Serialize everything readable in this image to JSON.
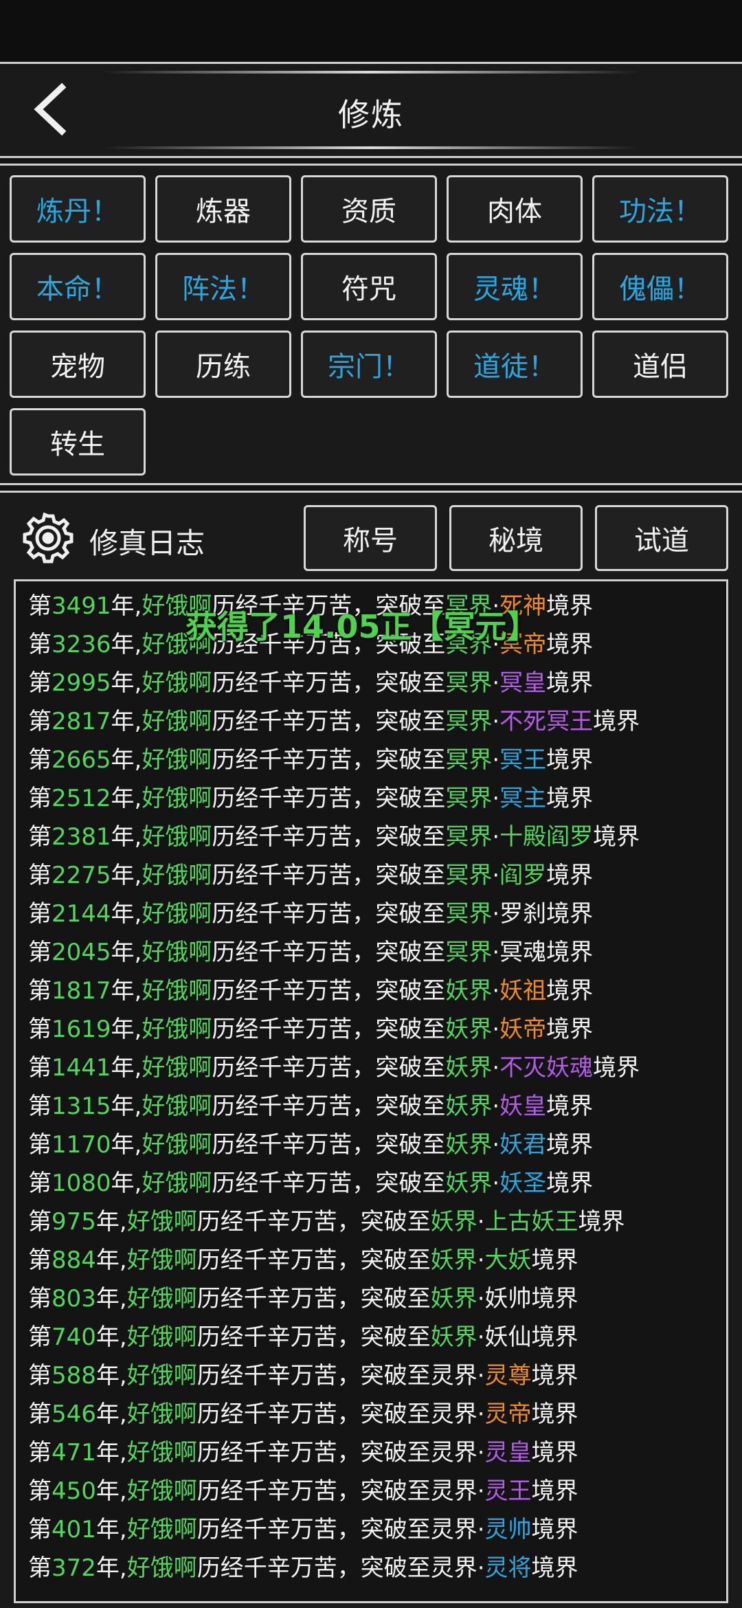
{
  "header": {
    "title": "修炼"
  },
  "feature_buttons": [
    {
      "label": "炼丹！",
      "alert": true
    },
    {
      "label": "炼器",
      "alert": false
    },
    {
      "label": "资质",
      "alert": false
    },
    {
      "label": "肉体",
      "alert": false
    },
    {
      "label": "功法！",
      "alert": true
    },
    {
      "label": "本命！",
      "alert": true
    },
    {
      "label": "阵法！",
      "alert": true
    },
    {
      "label": "符咒",
      "alert": false
    },
    {
      "label": "灵魂！",
      "alert": true
    },
    {
      "label": "傀儡！",
      "alert": true
    },
    {
      "label": "宠物",
      "alert": false
    },
    {
      "label": "历练",
      "alert": false
    },
    {
      "label": "宗门！",
      "alert": true
    },
    {
      "label": "道徒！",
      "alert": true
    },
    {
      "label": "道侣",
      "alert": false
    },
    {
      "label": "转生",
      "alert": false
    }
  ],
  "log_panel": {
    "title": "修真日志",
    "tabs": [
      "称号",
      "秘境",
      "试道"
    ]
  },
  "toast": "获得了14.05正【冥元】",
  "colors": {
    "green": "#54d65e",
    "orange": "#f08a24",
    "purple": "#b35ce8",
    "blue": "#2aa7e0",
    "white": "#f2f2f2",
    "alert": "#2aa7e0"
  },
  "log_entries": [
    {
      "prefix": "第",
      "year": "3491",
      "mid": "年,",
      "name": "好饿啊",
      "text": "历经千辛万苦，突破至",
      "realm": "冥界",
      "realm_color": "green",
      "dot": "·",
      "rank": "死神",
      "rank_color": "orange",
      "suffix": "境界"
    },
    {
      "prefix": "第",
      "year": "3236",
      "mid": "年,",
      "name": "好饿啊",
      "text": "历经千辛万苦，突破至",
      "realm": "冥界",
      "realm_color": "green",
      "dot": "·",
      "rank": "冥帝",
      "rank_color": "orange",
      "suffix": "境界"
    },
    {
      "prefix": "第",
      "year": "2995",
      "mid": "年,",
      "name": "好饿啊",
      "text": "历经千辛万苦，突破至",
      "realm": "冥界",
      "realm_color": "green",
      "dot": "·",
      "rank": "冥皇",
      "rank_color": "purple",
      "suffix": "境界"
    },
    {
      "prefix": "第",
      "year": "2817",
      "mid": "年,",
      "name": "好饿啊",
      "text": "历经千辛万苦，突破至",
      "realm": "冥界",
      "realm_color": "green",
      "dot": "·",
      "rank": "不死冥王",
      "rank_color": "purple",
      "suffix": "境界"
    },
    {
      "prefix": "第",
      "year": "2665",
      "mid": "年,",
      "name": "好饿啊",
      "text": "历经千辛万苦，突破至",
      "realm": "冥界",
      "realm_color": "green",
      "dot": "·",
      "rank": "冥王",
      "rank_color": "blue",
      "suffix": "境界"
    },
    {
      "prefix": "第",
      "year": "2512",
      "mid": "年,",
      "name": "好饿啊",
      "text": "历经千辛万苦，突破至",
      "realm": "冥界",
      "realm_color": "green",
      "dot": "·",
      "rank": "冥主",
      "rank_color": "blue",
      "suffix": "境界"
    },
    {
      "prefix": "第",
      "year": "2381",
      "mid": "年,",
      "name": "好饿啊",
      "text": "历经千辛万苦，突破至",
      "realm": "冥界",
      "realm_color": "green",
      "dot": "·",
      "rank": "十殿阎罗",
      "rank_color": "green",
      "suffix": "境界"
    },
    {
      "prefix": "第",
      "year": "2275",
      "mid": "年,",
      "name": "好饿啊",
      "text": "历经千辛万苦，突破至",
      "realm": "冥界",
      "realm_color": "green",
      "dot": "·",
      "rank": "阎罗",
      "rank_color": "green",
      "suffix": "境界"
    },
    {
      "prefix": "第",
      "year": "2144",
      "mid": "年,",
      "name": "好饿啊",
      "text": "历经千辛万苦，突破至",
      "realm": "冥界",
      "realm_color": "green",
      "dot": "·",
      "rank": "罗刹",
      "rank_color": "white",
      "suffix": "境界"
    },
    {
      "prefix": "第",
      "year": "2045",
      "mid": "年,",
      "name": "好饿啊",
      "text": "历经千辛万苦，突破至",
      "realm": "冥界",
      "realm_color": "green",
      "dot": "·",
      "rank": "冥魂",
      "rank_color": "white",
      "suffix": "境界"
    },
    {
      "prefix": "第",
      "year": "1817",
      "mid": "年,",
      "name": "好饿啊",
      "text": "历经千辛万苦，突破至",
      "realm": "妖界",
      "realm_color": "green",
      "dot": "·",
      "rank": "妖祖",
      "rank_color": "orange",
      "suffix": "境界"
    },
    {
      "prefix": "第",
      "year": "1619",
      "mid": "年,",
      "name": "好饿啊",
      "text": "历经千辛万苦，突破至",
      "realm": "妖界",
      "realm_color": "green",
      "dot": "·",
      "rank": "妖帝",
      "rank_color": "orange",
      "suffix": "境界"
    },
    {
      "prefix": "第",
      "year": "1441",
      "mid": "年,",
      "name": "好饿啊",
      "text": "历经千辛万苦，突破至",
      "realm": "妖界",
      "realm_color": "green",
      "dot": "·",
      "rank": "不灭妖魂",
      "rank_color": "purple",
      "suffix": "境界"
    },
    {
      "prefix": "第",
      "year": "1315",
      "mid": "年,",
      "name": "好饿啊",
      "text": "历经千辛万苦，突破至",
      "realm": "妖界",
      "realm_color": "green",
      "dot": "·",
      "rank": "妖皇",
      "rank_color": "purple",
      "suffix": "境界"
    },
    {
      "prefix": "第",
      "year": "1170",
      "mid": "年,",
      "name": "好饿啊",
      "text": "历经千辛万苦，突破至",
      "realm": "妖界",
      "realm_color": "green",
      "dot": "·",
      "rank": "妖君",
      "rank_color": "blue",
      "suffix": "境界"
    },
    {
      "prefix": "第",
      "year": "1080",
      "mid": "年,",
      "name": "好饿啊",
      "text": "历经千辛万苦，突破至",
      "realm": "妖界",
      "realm_color": "green",
      "dot": "·",
      "rank": "妖圣",
      "rank_color": "blue",
      "suffix": "境界"
    },
    {
      "prefix": "第",
      "year": "975",
      "mid": "年,",
      "name": "好饿啊",
      "text": "历经千辛万苦，突破至",
      "realm": "妖界",
      "realm_color": "green",
      "dot": "·",
      "rank": "上古妖王",
      "rank_color": "green",
      "suffix": "境界"
    },
    {
      "prefix": "第",
      "year": "884",
      "mid": "年,",
      "name": "好饿啊",
      "text": "历经千辛万苦，突破至",
      "realm": "妖界",
      "realm_color": "green",
      "dot": "·",
      "rank": "大妖",
      "rank_color": "green",
      "suffix": "境界"
    },
    {
      "prefix": "第",
      "year": "803",
      "mid": "年,",
      "name": "好饿啊",
      "text": "历经千辛万苦，突破至",
      "realm": "妖界",
      "realm_color": "green",
      "dot": "·",
      "rank": "妖帅",
      "rank_color": "white",
      "suffix": "境界"
    },
    {
      "prefix": "第",
      "year": "740",
      "mid": "年,",
      "name": "好饿啊",
      "text": "历经千辛万苦，突破至",
      "realm": "妖界",
      "realm_color": "green",
      "dot": "·",
      "rank": "妖仙",
      "rank_color": "white",
      "suffix": "境界"
    },
    {
      "prefix": "第",
      "year": "588",
      "mid": "年,",
      "name": "好饿啊",
      "text": "历经千辛万苦，突破至",
      "realm": "灵界",
      "realm_color": "white",
      "dot": "·",
      "rank": "灵尊",
      "rank_color": "orange",
      "suffix": "境界"
    },
    {
      "prefix": "第",
      "year": "546",
      "mid": "年,",
      "name": "好饿啊",
      "text": "历经千辛万苦，突破至",
      "realm": "灵界",
      "realm_color": "white",
      "dot": "·",
      "rank": "灵帝",
      "rank_color": "orange",
      "suffix": "境界"
    },
    {
      "prefix": "第",
      "year": "471",
      "mid": "年,",
      "name": "好饿啊",
      "text": "历经千辛万苦，突破至",
      "realm": "灵界",
      "realm_color": "white",
      "dot": "·",
      "rank": "灵皇",
      "rank_color": "purple",
      "suffix": "境界"
    },
    {
      "prefix": "第",
      "year": "450",
      "mid": "年,",
      "name": "好饿啊",
      "text": "历经千辛万苦，突破至",
      "realm": "灵界",
      "realm_color": "white",
      "dot": "·",
      "rank": "灵王",
      "rank_color": "purple",
      "suffix": "境界"
    },
    {
      "prefix": "第",
      "year": "401",
      "mid": "年,",
      "name": "好饿啊",
      "text": "历经千辛万苦，突破至",
      "realm": "灵界",
      "realm_color": "white",
      "dot": "·",
      "rank": "灵帅",
      "rank_color": "blue",
      "suffix": "境界"
    },
    {
      "prefix": "第",
      "year": "372",
      "mid": "年,",
      "name": "好饿啊",
      "text": "历经千辛万苦，突破至",
      "realm": "灵界",
      "realm_color": "white",
      "dot": "·",
      "rank": "灵将",
      "rank_color": "blue",
      "suffix": "境界"
    }
  ]
}
